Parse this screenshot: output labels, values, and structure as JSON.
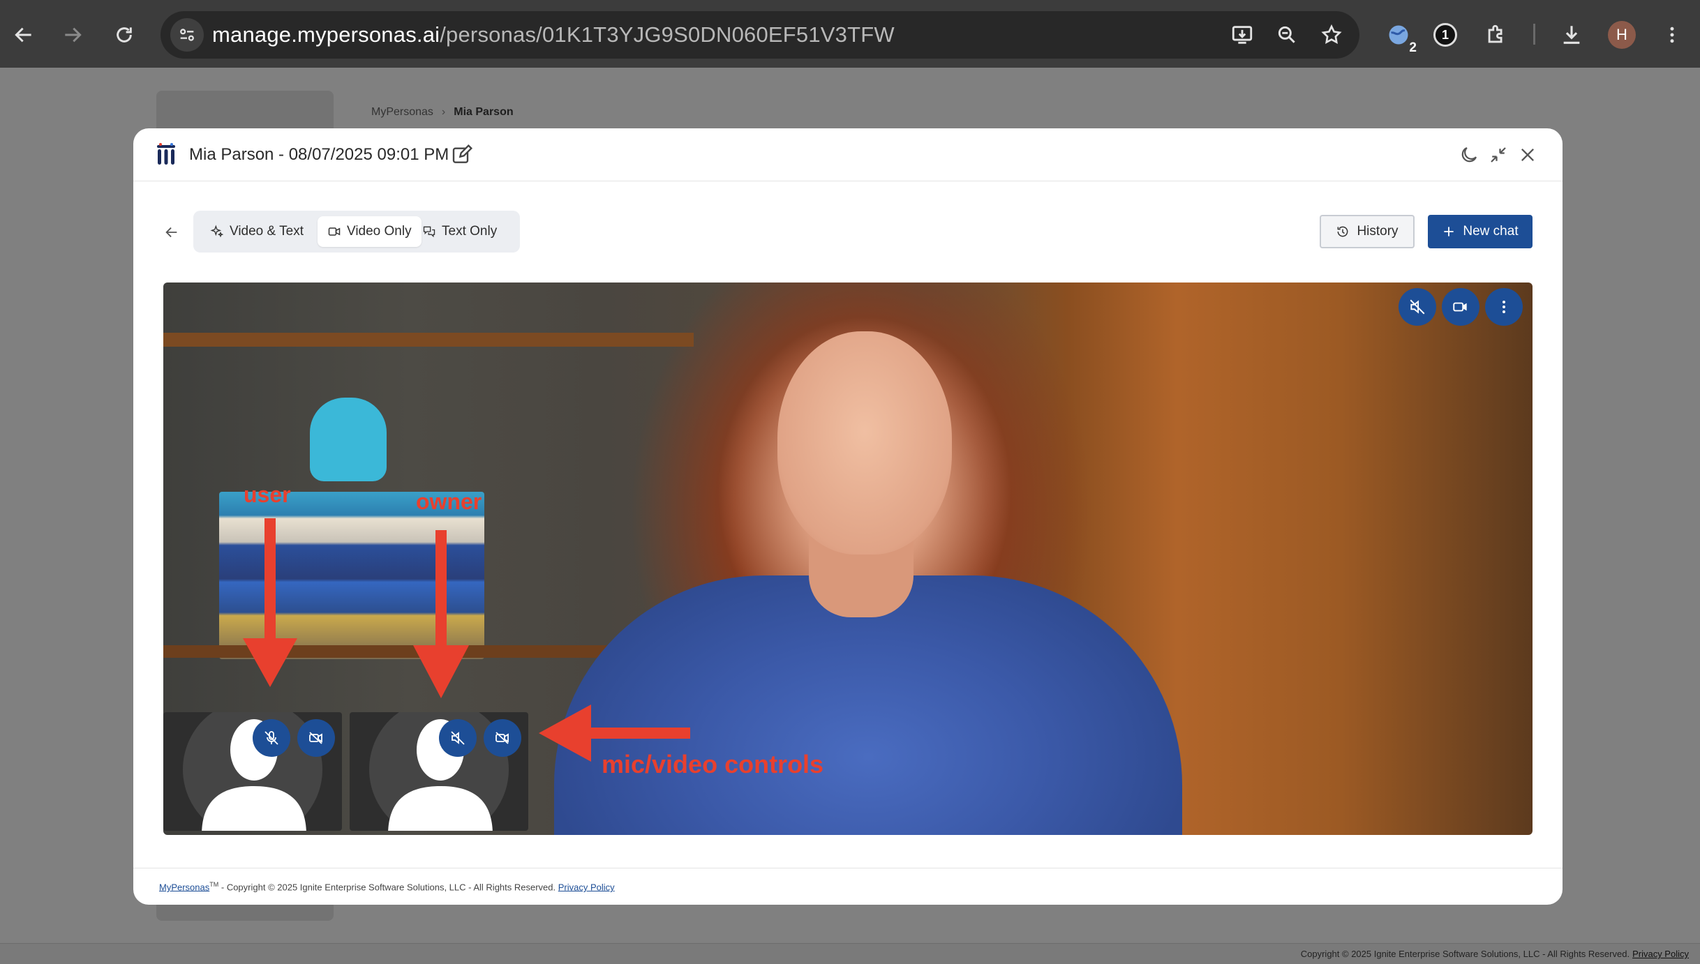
{
  "browser": {
    "url_host": "manage.mypersonas.ai",
    "url_path": "/personas/01K1T3YJG9S0DN060EF51V3TFW",
    "extension_badge": "2",
    "password_manager_badge": "1",
    "profile_initial": "H",
    "icons": [
      "back-arrow-icon",
      "forward-arrow-icon",
      "reload-icon",
      "site-settings-icon",
      "install-app-icon",
      "zoom-icon",
      "bookmark-star-icon",
      "extension-icon",
      "onepassword-icon",
      "puzzle-icon",
      "download-icon",
      "kebab-menu-icon"
    ]
  },
  "background_page": {
    "breadcrumb": [
      "MyPersonas",
      "Mia Parson"
    ],
    "footer_copyright": "Copyright © 2025 Ignite Enterprise Software Solutions, LLC - All Rights Reserved.",
    "footer_privacy": "Privacy Policy"
  },
  "modal": {
    "title": "Mia Parson - 08/07/2025 09:01 PM",
    "modes": [
      {
        "label": "Video & Text",
        "icon": "sparkles-icon",
        "active": false
      },
      {
        "label": "Video Only",
        "icon": "video-camera-icon",
        "active": true
      },
      {
        "label": "Text Only",
        "icon": "chat-bubbles-icon",
        "active": false
      }
    ],
    "history_label": "History",
    "new_chat_label": "New chat",
    "video_controls": [
      "speaker-muted-icon",
      "video-camera-icon",
      "more-vertical-icon"
    ],
    "participants": [
      {
        "role": "user",
        "controls": [
          "mic-off-icon",
          "video-off-icon"
        ]
      },
      {
        "role": "owner",
        "controls": [
          "speaker-muted-icon",
          "video-off-icon"
        ]
      }
    ],
    "annotations": {
      "user": "user",
      "owner": "owner",
      "controls": "mic/video controls"
    },
    "footer": {
      "brand": "MyPersonas",
      "tm": "TM",
      "copyright": "- Copyright © 2025 Ignite Enterprise Software Solutions, LLC - All Rights Reserved.",
      "privacy": "Privacy Policy"
    }
  },
  "colors": {
    "primary": "#1d4e96",
    "annotation": "#e8402e",
    "chrome_bg": "#3c3c3c",
    "overlay_bg": "#808080"
  }
}
